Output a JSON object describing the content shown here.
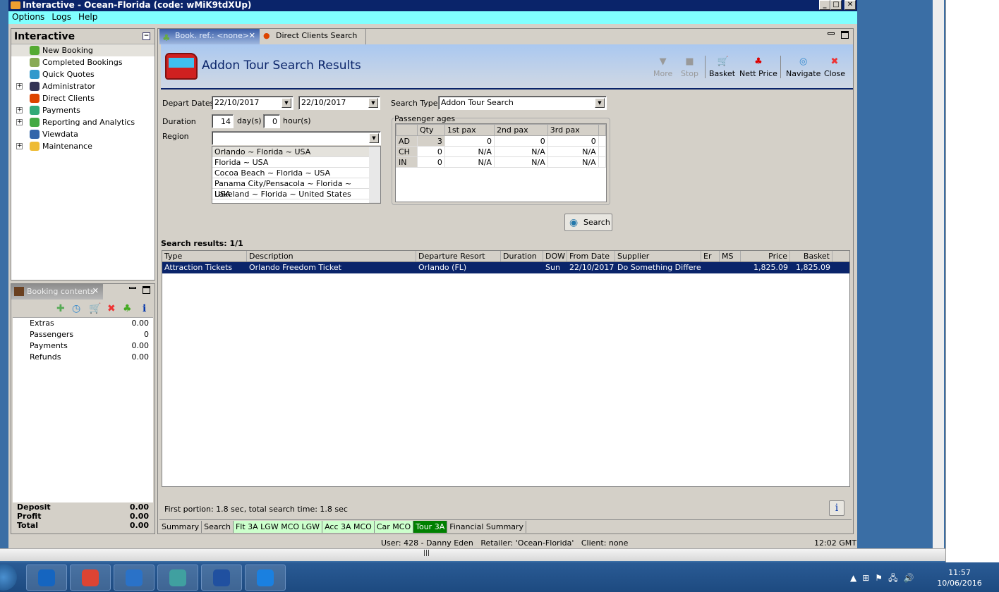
{
  "window": {
    "title": "Interactive - Ocean-Florida (code: wMiK9tdXUp)"
  },
  "menu": [
    "Options",
    "Logs",
    "Help"
  ],
  "nav": {
    "title": "Interactive",
    "items": [
      {
        "label": "New Booking",
        "icon": "palm-tree-icon",
        "expandable": false,
        "selected": true
      },
      {
        "label": "Completed Bookings",
        "icon": "palm-money-icon",
        "expandable": false
      },
      {
        "label": "Quick Quotes",
        "icon": "clock-icon",
        "expandable": false
      },
      {
        "label": "Administrator",
        "icon": "runner-icon",
        "expandable": true
      },
      {
        "label": "Direct Clients",
        "icon": "person-icon",
        "expandable": false
      },
      {
        "label": "Payments",
        "icon": "dollar-card-icon",
        "expandable": true
      },
      {
        "label": "Reporting and Analytics",
        "icon": "report-icon",
        "expandable": true
      },
      {
        "label": "Viewdata",
        "icon": "globe-icon",
        "expandable": false
      },
      {
        "label": "Maintenance",
        "icon": "books-icon",
        "expandable": true
      }
    ]
  },
  "booking_contents": {
    "title": "Booking contents",
    "rows": [
      {
        "label": "Extras",
        "value": "0.00"
      },
      {
        "label": "Passengers",
        "value": "0"
      },
      {
        "label": "Payments",
        "value": "0.00"
      },
      {
        "label": "Refunds",
        "value": "0.00"
      }
    ],
    "totals": [
      {
        "label": "Deposit",
        "value": "0.00"
      },
      {
        "label": "Profit",
        "value": "0.00"
      },
      {
        "label": "Total",
        "value": "0.00"
      }
    ]
  },
  "tabs": [
    {
      "label": "Book. ref.: <none>",
      "active": true
    },
    {
      "label": "Direct Clients Search",
      "active": false
    }
  ],
  "header": {
    "title": "Addon Tour Search Results"
  },
  "toolbar": {
    "more": "More",
    "stop": "Stop",
    "basket": "Basket",
    "nett_price": "Nett Price",
    "navigate": "Navigate",
    "close": "Close"
  },
  "form": {
    "depart_dates_label": "Depart Dates",
    "date_from": "22/10/2017",
    "date_to": "22/10/2017",
    "duration_label": "Duration",
    "days": "14",
    "days_unit": "day(s)",
    "hours": "0",
    "hours_unit": "hour(s)",
    "region_label": "Region",
    "region_value": "",
    "regions": [
      "Orlando ~ Florida ~ USA",
      "Florida ~ USA",
      "Cocoa Beach ~ Florida ~ USA",
      "Panama City/Pensacola ~  Florida  ~ USA",
      "Lakeland ~ Florida ~ United States"
    ],
    "search_type_label": "Search Type",
    "search_type": "Addon Tour Search",
    "search_button": "Search"
  },
  "passenger_ages": {
    "title": "Passenger ages",
    "columns": [
      "",
      "Qty",
      "1st pax",
      "2nd pax",
      "3rd pax",
      ""
    ],
    "rows": [
      [
        "AD",
        "3",
        "0",
        "0",
        "0",
        ""
      ],
      [
        "CH",
        "0",
        "N/A",
        "N/A",
        "N/A",
        ""
      ],
      [
        "IN",
        "0",
        "N/A",
        "N/A",
        "N/A",
        ""
      ]
    ]
  },
  "results": {
    "label": "Search results: 1/1",
    "columns": [
      "Type",
      "Description",
      "Departure Resort",
      "Duration",
      "DOW",
      "From Date",
      "Supplier",
      "Er",
      "MS",
      "Price",
      "Basket"
    ],
    "rows": [
      [
        "Attraction Tickets",
        "Orlando Freedom Ticket",
        "Orlando (FL)",
        "",
        "Sun",
        "22/10/2017",
        "Do Something Different",
        "",
        "",
        "1,825.09",
        "1,825.09"
      ]
    ]
  },
  "timing": "First portion: 1.8 sec, total search time: 1.8 sec",
  "bottom_tabs": [
    {
      "label": "Summary",
      "color": "#d4d0c8"
    },
    {
      "label": "Search",
      "color": "#d4d0c8"
    },
    {
      "label": "Flt 3A LGW MCO LGW",
      "color": "#ccffcc"
    },
    {
      "label": "Acc 3A MCO",
      "color": "#ccffcc"
    },
    {
      "label": "Car MCO",
      "color": "#ccffcc"
    },
    {
      "label": "Tour 3A",
      "color": "#008000",
      "active": true
    },
    {
      "label": "Financial Summary",
      "color": "#d4d0c8"
    }
  ],
  "status": {
    "user": "User: 428 - Danny Eden",
    "retailer": "Retailer: 'Ocean-Florida'",
    "client": "Client: none",
    "time": "12:02 GMT"
  },
  "taskbar": {
    "apps": [
      "outlook-icon",
      "chrome-icon",
      "ie-document-icon",
      "app-icon",
      "remote-desktop-icon",
      "g-app-icon"
    ],
    "clock_time": "11:57",
    "clock_date": "10/06/2016"
  }
}
